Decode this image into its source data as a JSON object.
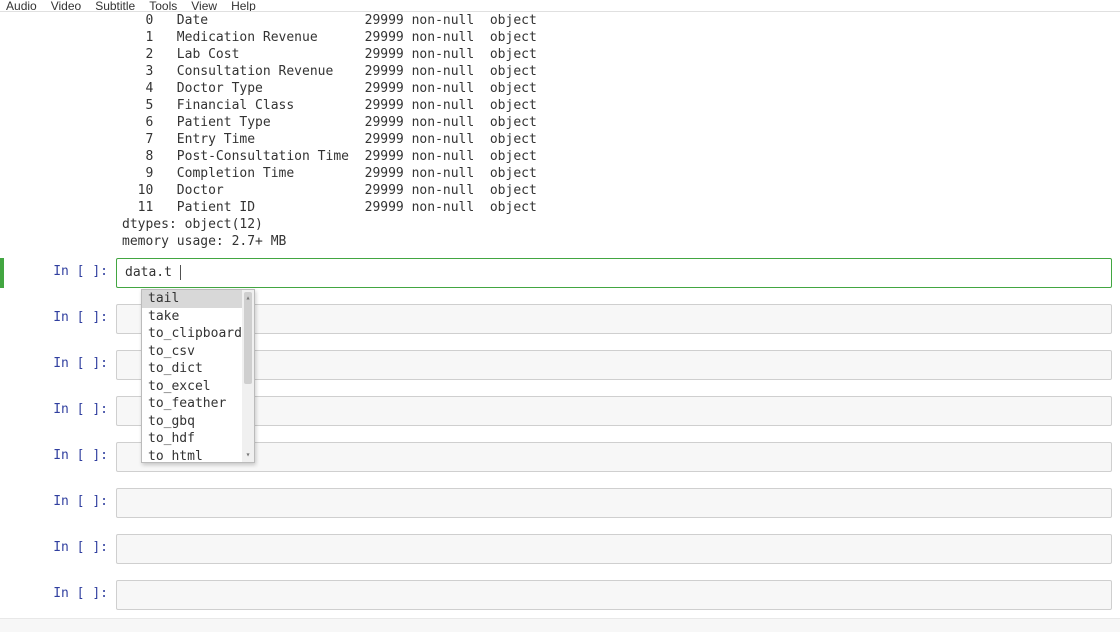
{
  "menubar": {
    "items": [
      "Audio",
      "Video",
      "Subtitle",
      "Tools",
      "View",
      "Help"
    ]
  },
  "output": {
    "rows": [
      {
        "idx": "0",
        "col": "Date",
        "count": "29999 non-null",
        "dtype": "object"
      },
      {
        "idx": "1",
        "col": "Medication Revenue",
        "count": "29999 non-null",
        "dtype": "object"
      },
      {
        "idx": "2",
        "col": "Lab Cost",
        "count": "29999 non-null",
        "dtype": "object"
      },
      {
        "idx": "3",
        "col": "Consultation Revenue",
        "count": "29999 non-null",
        "dtype": "object"
      },
      {
        "idx": "4",
        "col": "Doctor Type",
        "count": "29999 non-null",
        "dtype": "object"
      },
      {
        "idx": "5",
        "col": "Financial Class",
        "count": "29999 non-null",
        "dtype": "object"
      },
      {
        "idx": "6",
        "col": "Patient Type",
        "count": "29999 non-null",
        "dtype": "object"
      },
      {
        "idx": "7",
        "col": "Entry Time",
        "count": "29999 non-null",
        "dtype": "object"
      },
      {
        "idx": "8",
        "col": "Post-Consultation Time",
        "count": "29999 non-null",
        "dtype": "object"
      },
      {
        "idx": "9",
        "col": "Completion Time",
        "count": "29999 non-null",
        "dtype": "object"
      },
      {
        "idx": "10",
        "col": "Doctor",
        "count": "29999 non-null",
        "dtype": "object"
      },
      {
        "idx": "11",
        "col": "Patient ID",
        "count": "29999 non-null",
        "dtype": "object"
      }
    ],
    "footer1": "dtypes: object(12)",
    "footer2": "memory usage: 2.7+ MB"
  },
  "cells": [
    {
      "prompt": "In [ ]:",
      "content": "data.t",
      "selected": true
    },
    {
      "prompt": "In [ ]:",
      "content": ""
    },
    {
      "prompt": "In [ ]:",
      "content": ""
    },
    {
      "prompt": "In [ ]:",
      "content": ""
    },
    {
      "prompt": "In [ ]:",
      "content": ""
    },
    {
      "prompt": "In [ ]:",
      "content": ""
    },
    {
      "prompt": "In [ ]:",
      "content": ""
    },
    {
      "prompt": "In [ ]:",
      "content": ""
    }
  ],
  "autocomplete": {
    "items": [
      "tail",
      "take",
      "to_clipboard",
      "to_csv",
      "to_dict",
      "to_excel",
      "to_feather",
      "to_gbq",
      "to_hdf",
      "to_html"
    ],
    "selectedIndex": 0
  }
}
